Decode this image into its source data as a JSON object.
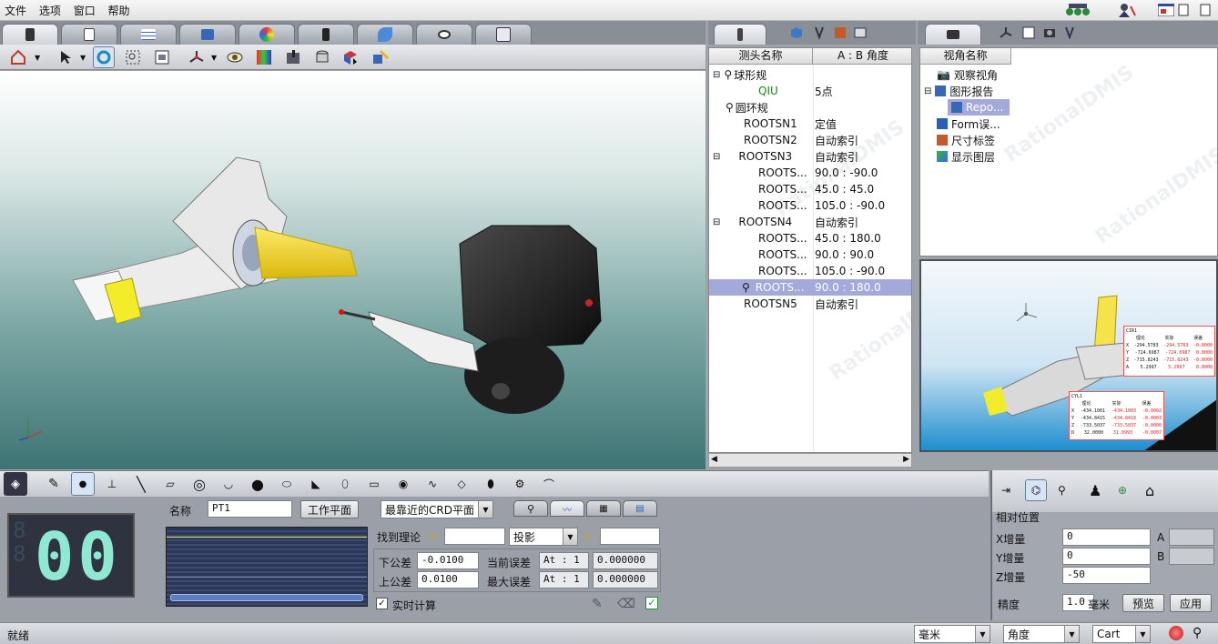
{
  "menubar": {
    "items": [
      "文件",
      "选项",
      "窗口",
      "帮助"
    ]
  },
  "probe_panel": {
    "headers": [
      "测头名称",
      "A : B 角度"
    ],
    "rows": [
      {
        "name": "球形规",
        "value": ""
      },
      {
        "name": "QIU",
        "value": "5点"
      },
      {
        "name": "圆环规",
        "value": ""
      },
      {
        "name": "ROOTSN1",
        "value": "定值"
      },
      {
        "name": "ROOTSN2",
        "value": "自动索引"
      },
      {
        "name": "ROOTSN3",
        "value": "自动索引"
      },
      {
        "name": "ROOTS...",
        "value": "90.0 : -90.0"
      },
      {
        "name": "ROOTS...",
        "value": "45.0 : 45.0"
      },
      {
        "name": "ROOTS...",
        "value": "105.0 : -90.0"
      },
      {
        "name": "ROOTSN4",
        "value": "自动索引"
      },
      {
        "name": "ROOTS...",
        "value": "45.0 : 180.0"
      },
      {
        "name": "ROOTS...",
        "value": "90.0 : 90.0"
      },
      {
        "name": "ROOTS...",
        "value": "105.0 : -90.0"
      },
      {
        "name": "ROOTS...",
        "value": "90.0 : 180.0"
      },
      {
        "name": "ROOTSN5",
        "value": "自动索引"
      }
    ]
  },
  "view_panel": {
    "header": "视角名称",
    "items": [
      "观察视角",
      "图形报告",
      "Repo...",
      "Form误...",
      "尺寸标签",
      "显示图层"
    ]
  },
  "preview_tables": {
    "t1": {
      "title": "CIR1",
      "headers": [
        "理论",
        "实际",
        "误差"
      ],
      "rows": [
        [
          "X",
          "-294.5783",
          "-294.5783",
          "-0.0000"
        ],
        [
          "Y",
          "-724.6987",
          "-724.6987",
          "0.0000"
        ],
        [
          "Z",
          "-715.8243",
          "-715.8243",
          "-0.0000"
        ],
        [
          "A",
          "5.2997",
          "5.2997",
          "0.0000"
        ]
      ]
    },
    "t2": {
      "title": "CYL1",
      "headers": [
        "理论",
        "实际",
        "误差"
      ],
      "rows": [
        [
          "X",
          "-434.1001",
          "-434.1003",
          "-0.0002"
        ],
        [
          "Y",
          "-434.8415",
          "-434.8418",
          "-0.0003"
        ],
        [
          "Z",
          "-733.5037",
          "-733.5037",
          "-0.0000"
        ],
        [
          "D",
          "32.0000",
          "31.9993",
          "-0.0007"
        ]
      ]
    }
  },
  "feature_panel": {
    "counter": "00",
    "name_label": "名称",
    "name_value": "PT1",
    "work_plane_button": "工作平面",
    "plane_select": "最靠近的CRD平面",
    "find_nominal_label": "找到理论",
    "projection_select": "投影",
    "lower_tol_label": "下公差",
    "lower_tol_value": "-0.0100",
    "upper_tol_label": "上公差",
    "upper_tol_value": "0.0100",
    "current_err_label": "当前误差",
    "current_err_at": "At : 1",
    "current_err_value": "0.000000",
    "max_err_label": "最大误差",
    "max_err_at": "At : 1",
    "max_err_value": "0.000000",
    "realtime_label": "实时计算"
  },
  "move_panel": {
    "title": "相对位置",
    "x_label": "X增量",
    "x_value": "0",
    "y_label": "Y增量",
    "y_value": "0",
    "z_label": "Z增量",
    "z_value": "-50",
    "a_label": "A",
    "b_label": "B",
    "precision_label": "精度",
    "precision_value": "1.0",
    "unit": "毫米",
    "preview_button": "预览",
    "apply_button": "应用"
  },
  "statusbar": {
    "status": "就绪",
    "unit_select": "毫米",
    "angle_select": "角度",
    "coord_select": "Cart"
  },
  "viewport": {
    "watermark": "RationalDMIS"
  }
}
